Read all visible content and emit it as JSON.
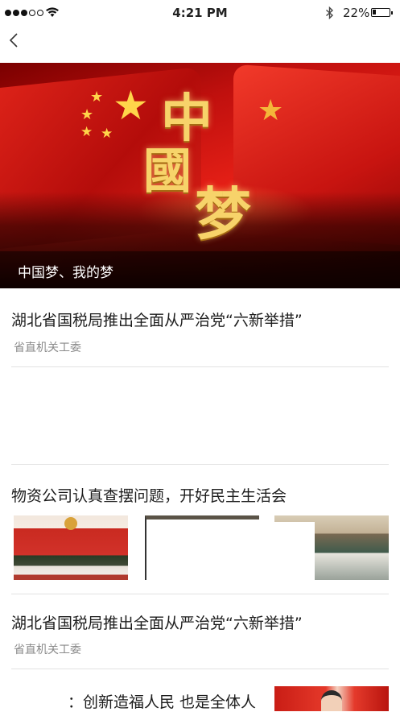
{
  "status_bar": {
    "signal_dots_filled": 3,
    "signal_dots_total": 5,
    "time": "4:21 PM",
    "battery_percent_text": "22%",
    "battery_level": 0.22,
    "icons": [
      "wifi-icon",
      "bluetooth-icon",
      "battery-icon"
    ]
  },
  "nav": {
    "back_icon": "chevron-left-icon"
  },
  "banner": {
    "calligraphy": [
      "中",
      "國",
      "梦"
    ],
    "caption": "中国梦、我的梦"
  },
  "articles": [
    {
      "title": "湖北省国税局推出全面从严治党“六新举措”",
      "source": "省直机关工委"
    },
    {
      "title": "物资公司认真查摆问题，开好民主生活会"
    },
    {
      "title": "湖北省国税局推出全面从严治党“六新举措”",
      "source": "省直机关工委"
    },
    {
      "title": "：创新造福人民 也是全体人"
    }
  ],
  "colors": {
    "banner_red": "#e41f16",
    "calligraphy_gold": "#f7d36a",
    "star_gold": "#ffd54a",
    "divider": "#e2e2e2",
    "source_gray": "#8a8a8a"
  }
}
